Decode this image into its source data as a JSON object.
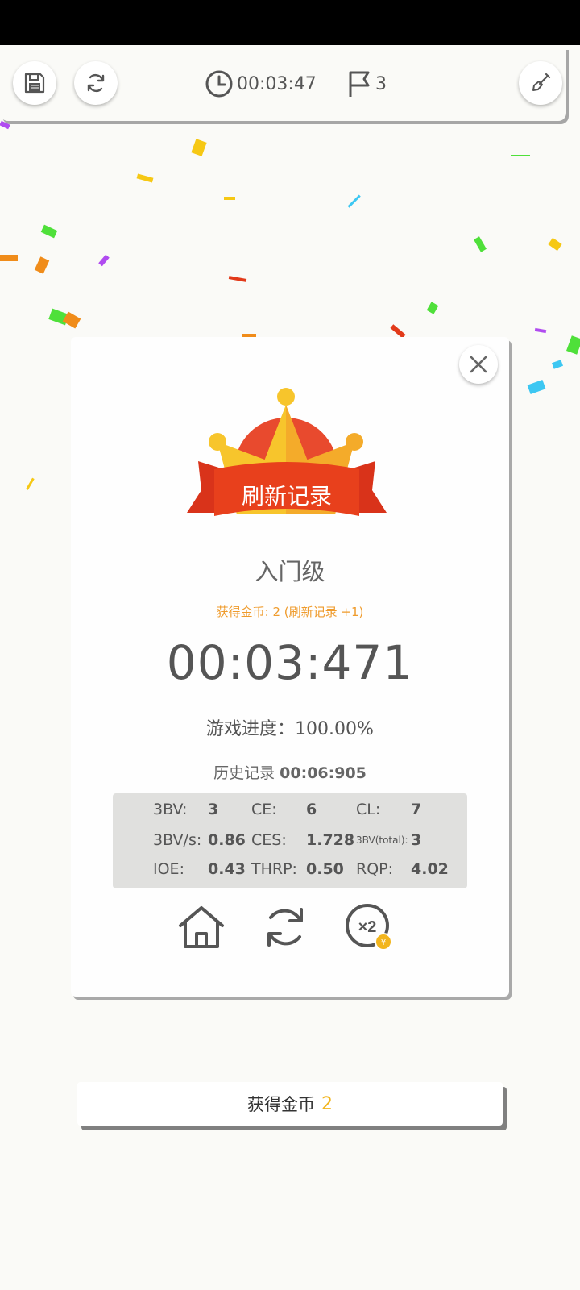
{
  "toolbar": {
    "save_icon": "floppy-disk-icon",
    "refresh_icon": "refresh-icon",
    "timer": "00:03:47",
    "flag_count": "3",
    "shovel_icon": "shovel-icon"
  },
  "dialog": {
    "banner_text": "刷新记录",
    "level": "入门级",
    "coins_note": "获得金币: 2 (刷新记录 +1)",
    "time": "00:03:471",
    "progress_label": "游戏进度：",
    "progress_value": "100.00%",
    "history_label": "历史记录",
    "history_value": "00:06:905",
    "stats": [
      [
        {
          "label": "3BV:",
          "value": "3"
        },
        {
          "label": "CE:",
          "value": "6"
        },
        {
          "label": "CL:",
          "value": "7"
        }
      ],
      [
        {
          "label": "3BV/s:",
          "value": "0.86"
        },
        {
          "label": "CES:",
          "value": "1.728"
        },
        {
          "label": "3BV(total):",
          "value": "3"
        }
      ],
      [
        {
          "label": "IOE:",
          "value": "0.43"
        },
        {
          "label": "THRP:",
          "value": "0.50"
        },
        {
          "label": "RQP:",
          "value": "4.02"
        }
      ]
    ],
    "actions": {
      "home_icon": "home-icon",
      "replay_icon": "replay-icon",
      "double_icon": "double-coins-icon",
      "double_text": "×2"
    },
    "colors": {
      "crown_gold": "#f7c52c",
      "banner_red": "#e8401c",
      "coin_orange": "#ef9b2c"
    }
  },
  "coins_bar": {
    "label": "获得金币",
    "amount": "2"
  }
}
